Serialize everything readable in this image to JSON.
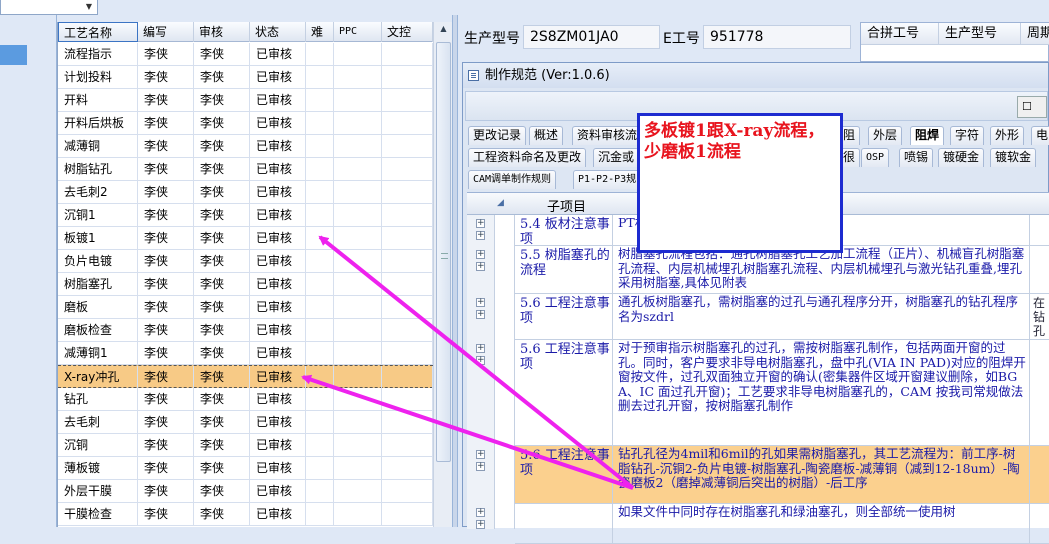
{
  "combo": {
    "value": ""
  },
  "grid": {
    "columns": [
      "工艺名称",
      "编写",
      "审核",
      "状态",
      "难",
      "PPC",
      "文控"
    ],
    "rows": [
      {
        "name": "流程指示",
        "author": "李侠",
        "reviewer": "李侠",
        "status": "已审核"
      },
      {
        "name": "计划投料",
        "author": "李侠",
        "reviewer": "李侠",
        "status": "已审核"
      },
      {
        "name": "开料",
        "author": "李侠",
        "reviewer": "李侠",
        "status": "已审核"
      },
      {
        "name": "开料后烘板",
        "author": "李侠",
        "reviewer": "李侠",
        "status": "已审核"
      },
      {
        "name": "减薄铜",
        "author": "李侠",
        "reviewer": "李侠",
        "status": "已审核"
      },
      {
        "name": "树脂钻孔",
        "author": "李侠",
        "reviewer": "李侠",
        "status": "已审核"
      },
      {
        "name": "去毛刺2",
        "author": "李侠",
        "reviewer": "李侠",
        "status": "已审核"
      },
      {
        "name": "沉铜1",
        "author": "李侠",
        "reviewer": "李侠",
        "status": "已审核"
      },
      {
        "name": "板镀1",
        "author": "李侠",
        "reviewer": "李侠",
        "status": "已审核"
      },
      {
        "name": "负片电镀",
        "author": "李侠",
        "reviewer": "李侠",
        "status": "已审核"
      },
      {
        "name": "树脂塞孔",
        "author": "李侠",
        "reviewer": "李侠",
        "status": "已审核"
      },
      {
        "name": "磨板",
        "author": "李侠",
        "reviewer": "李侠",
        "status": "已审核"
      },
      {
        "name": "磨板检查",
        "author": "李侠",
        "reviewer": "李侠",
        "status": "已审核"
      },
      {
        "name": "减薄铜1",
        "author": "李侠",
        "reviewer": "李侠",
        "status": "已审核"
      },
      {
        "name": "X-ray冲孔",
        "author": "李侠",
        "reviewer": "李侠",
        "status": "已审核"
      },
      {
        "name": "钻孔",
        "author": "李侠",
        "reviewer": "李侠",
        "status": "已审核"
      },
      {
        "name": "去毛刺",
        "author": "李侠",
        "reviewer": "李侠",
        "status": "已审核"
      },
      {
        "name": "沉铜",
        "author": "李侠",
        "reviewer": "李侠",
        "status": "已审核"
      },
      {
        "name": "薄板镀",
        "author": "李侠",
        "reviewer": "李侠",
        "status": "已审核"
      },
      {
        "name": "外层干膜",
        "author": "李侠",
        "reviewer": "李侠",
        "status": "已审核"
      },
      {
        "name": "干膜检查",
        "author": "李侠",
        "reviewer": "李侠",
        "status": "已审核"
      }
    ],
    "selected_index": 14
  },
  "top_fields": {
    "model_label": "生产型号",
    "model_value": "2S8ZM01JA0",
    "ework_label": "E工号",
    "ework_value": "951778"
  },
  "merge_grid": {
    "columns": [
      "合拼工号",
      "生产型号",
      "周期"
    ]
  },
  "dialog": {
    "title": "制作规范 (Ver:1.0.6)",
    "tabs_row1": [
      "更改记录",
      "概述",
      "资料审核流",
      "阻",
      "外层",
      "阻焊",
      "字符",
      "外形",
      "电"
    ],
    "active_tab": "阻焊",
    "tabs_row2": [
      "工程资料命名及更改",
      "沉金或",
      "很",
      "OSP",
      "喷锡",
      "镀硬金",
      "镀软金"
    ],
    "tabs_row3": [
      "CAM调单制作规则",
      "P1-P2-P3规"
    ],
    "table_header": "子项目",
    "rows": [
      {
        "key": "5.4 板材注意事项",
        "value": "PT材料时不可以制作树脂塞孔",
        "extra": ""
      },
      {
        "key": "5.5 树脂塞孔的流程",
        "value": "树脂塞孔流程包括：通孔树脂塞孔工艺加工流程（正片）、机械盲孔树脂塞孔流程、内层机械埋孔树脂塞孔流程、内层机械埋孔与激光钻孔重叠,埋孔采用树脂塞,具体见附表",
        "extra": ""
      },
      {
        "key": "5.6 工程注意事项",
        "value": "通孔板树脂塞孔，需树脂塞的过孔与通孔程序分开，树脂塞孔的钻孔程序名为szdrl",
        "extra": "在钻孔"
      },
      {
        "key": "5.6 工程注意事项",
        "value": "对于预审指示树脂塞孔的过孔，需按树脂塞孔制作，包括两面开窗的过孔。同时，客户要求非导电树脂塞孔，盘中孔(VIA IN PAD)对应的阻焊开窗按文件，过孔双面独立开窗的确认(密集器件区域开窗建议删除，如BGA、IC 面过孔开窗)；工艺要求非导电树脂塞孔的，CAM 按我司常规做法删去过孔开窗，按树脂塞孔制作",
        "extra": ""
      },
      {
        "key": "5.6 工程注意事项",
        "value": "钻孔孔径为4mil和6mil的孔如果需树脂塞孔，其工艺流程为：前工序-树脂钻孔-沉铜2-负片电镀-树脂塞孔-陶瓷磨板-减薄铜（减到12-18um）-陶瓷磨板2（磨掉减薄铜后突出的树脂）-后工序",
        "extra": ""
      },
      {
        "key": "",
        "value": "如果文件中同时存在树脂塞孔和绿油塞孔，则全部统一使用树",
        "extra": ""
      }
    ],
    "highlight_index": 4
  },
  "annotation": {
    "text": "多板镀1跟X-ray流程，少磨板1流程"
  },
  "colors": {
    "selected_row": "#f7ca86",
    "highlight_row": "#fbd08e",
    "annotation_text": "#e8141e",
    "annotation_border": "#1d2bd0",
    "arrow": "#ee22ee"
  }
}
